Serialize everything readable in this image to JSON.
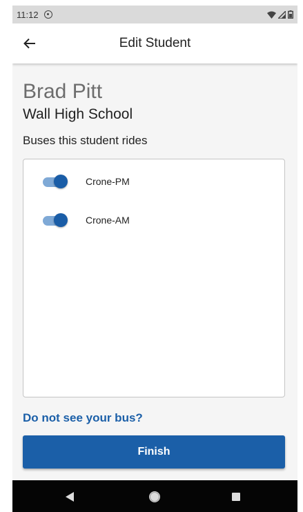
{
  "status_bar": {
    "time": "11:12"
  },
  "app_bar": {
    "title": "Edit Student"
  },
  "student": {
    "name": "Brad Pitt",
    "school": "Wall High School"
  },
  "buses_section": {
    "heading": "Buses this student rides",
    "buses": [
      {
        "label": "Crone-PM",
        "enabled": true
      },
      {
        "label": "Crone-AM",
        "enabled": true
      }
    ]
  },
  "help_link": "Do not see your bus?",
  "finish_label": "Finish",
  "colors": {
    "accent": "#1b5fa8",
    "toggle_track": "#7fa9d6",
    "toggle_thumb": "#1a5da7",
    "status_bar": "#dadada",
    "nav_bar": "#050505"
  },
  "icons": {
    "back": "arrow-left-icon",
    "nav_back": "triangle-back-icon",
    "nav_home": "circle-home-icon",
    "nav_recents": "square-recents-icon"
  }
}
